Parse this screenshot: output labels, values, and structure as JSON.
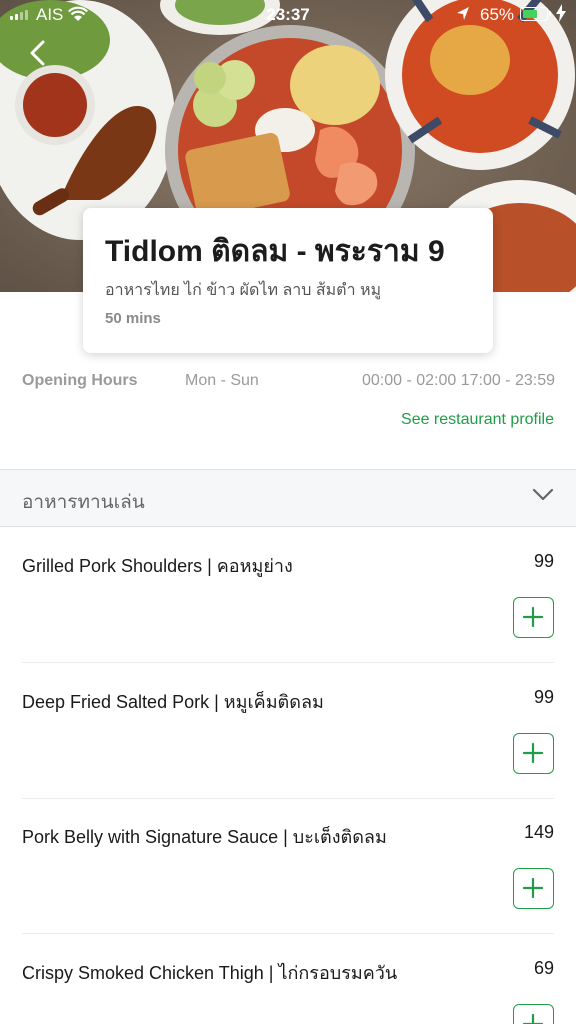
{
  "status_bar": {
    "carrier": "AIS",
    "time": "23:37",
    "battery": "65%",
    "battery_level": 0.65
  },
  "restaurant": {
    "name": "Tidlom ติดลม - พระราม 9",
    "cuisine": "อาหารไทย ไก่ ข้าว ผัดไท ลาบ ส้มตำ หมู",
    "eta": "50 mins"
  },
  "opening_hours": {
    "label": "Opening Hours",
    "days": "Mon - Sun",
    "times": "00:00 - 02:00 17:00 - 23:59"
  },
  "profile_link": "See restaurant profile",
  "category": {
    "title": "อาหารทานเล่น"
  },
  "menu_items": [
    {
      "name": "Grilled Pork Shoulders | คอหมูย่าง",
      "price": "99"
    },
    {
      "name": "Deep Fried Salted Pork | หมูเค็มติดลม",
      "price": "99"
    },
    {
      "name": "Pork Belly with Signature Sauce | บะเต็งติดลม",
      "price": "149"
    },
    {
      "name": "Crispy Smoked Chicken Thigh | ไก่กรอบรมควัน",
      "price": "69"
    }
  ],
  "colors": {
    "accent": "#1f9d47",
    "battery": "#44d15e"
  },
  "icons": [
    "signal-icon",
    "wifi-icon",
    "location-icon",
    "battery-icon",
    "charging-icon",
    "back-icon",
    "chevron-down-icon",
    "plus-icon"
  ]
}
